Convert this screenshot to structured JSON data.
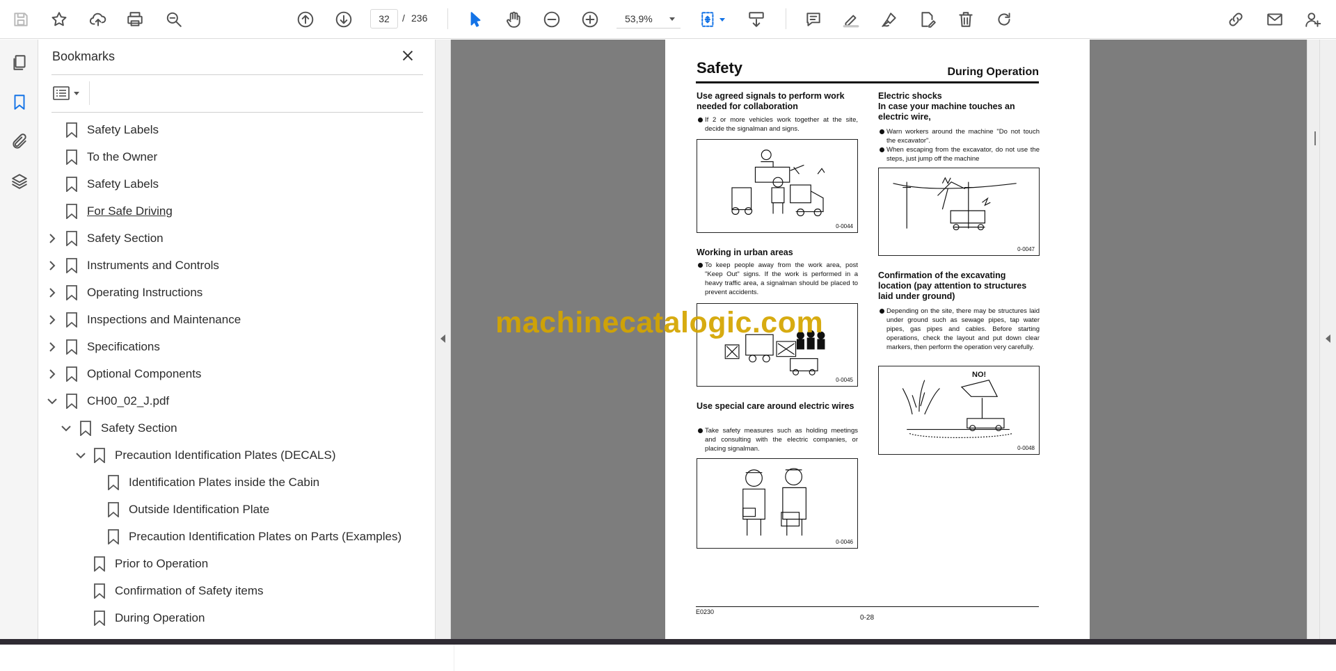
{
  "toolbar": {
    "current_page": "32",
    "page_separator": "/",
    "total_pages": "236",
    "zoom": "53,9%"
  },
  "bookmarks_panel": {
    "title": "Bookmarks",
    "items": [
      {
        "label": "Safety Labels"
      },
      {
        "label": "To the Owner"
      },
      {
        "label": "Safety Labels"
      },
      {
        "label": "For Safe Driving"
      },
      {
        "label": "Safety Section"
      },
      {
        "label": "Instruments and Controls"
      },
      {
        "label": "Operating Instructions"
      },
      {
        "label": "Inspections and Maintenance"
      },
      {
        "label": "Specifications"
      },
      {
        "label": "Optional Components"
      },
      {
        "label": "CH00_02_J.pdf"
      },
      {
        "label": "Safety Section"
      },
      {
        "label": "Precaution Identification Plates (DECALS)"
      },
      {
        "label": "Identification Plates inside the Cabin"
      },
      {
        "label": "Outside Identification Plate"
      },
      {
        "label": "Precaution Identification Plates on Parts (Examples)"
      },
      {
        "label": "Prior to Operation"
      },
      {
        "label": "Confirmation of Safety items"
      },
      {
        "label": "During Operation"
      }
    ]
  },
  "document": {
    "title": "Safety",
    "subtitle": "During Operation",
    "sections": [
      {
        "heading": "Use agreed signals to perform work needed for collaboration",
        "text": "If 2 or more vehicles work together at the site, decide the signalman and signs.",
        "figure_code": "0-0044"
      },
      {
        "heading": "Working in urban areas",
        "text": "To keep people away from the work area, post \"Keep Out\" signs. If the work is performed in a heavy traffic area, a signalman should be placed to prevent accidents.",
        "figure_code": "0-0045"
      },
      {
        "heading": "Use special care around electric wires",
        "text": "Take safety measures such as holding meetings and consulting with the electric companies, or placing signalman.",
        "figure_code": "0-0046"
      },
      {
        "heading": "Electric shocks\nIn case your machine touches an electric wire,",
        "text1": "Warn workers around the machine \"Do not touch the excavator\".",
        "text2": "When escaping from the excavator, do not use the steps, just jump off the machine",
        "figure_code": "0-0047"
      },
      {
        "heading": "Confirmation of the excavating location (pay attention to structures laid under ground)",
        "text": "Depending on the site, there may be structures laid under ground such as sewage pipes, tap water pipes, gas pipes and cables. Before starting operations, check the layout and put down clear markers, then perform the operation very carefully.",
        "figure_code": "0-0048",
        "figure_text": "NO!"
      }
    ],
    "footer_left": "E0230",
    "footer_page": "0-28"
  },
  "watermark": "machinecatalogic.com"
}
